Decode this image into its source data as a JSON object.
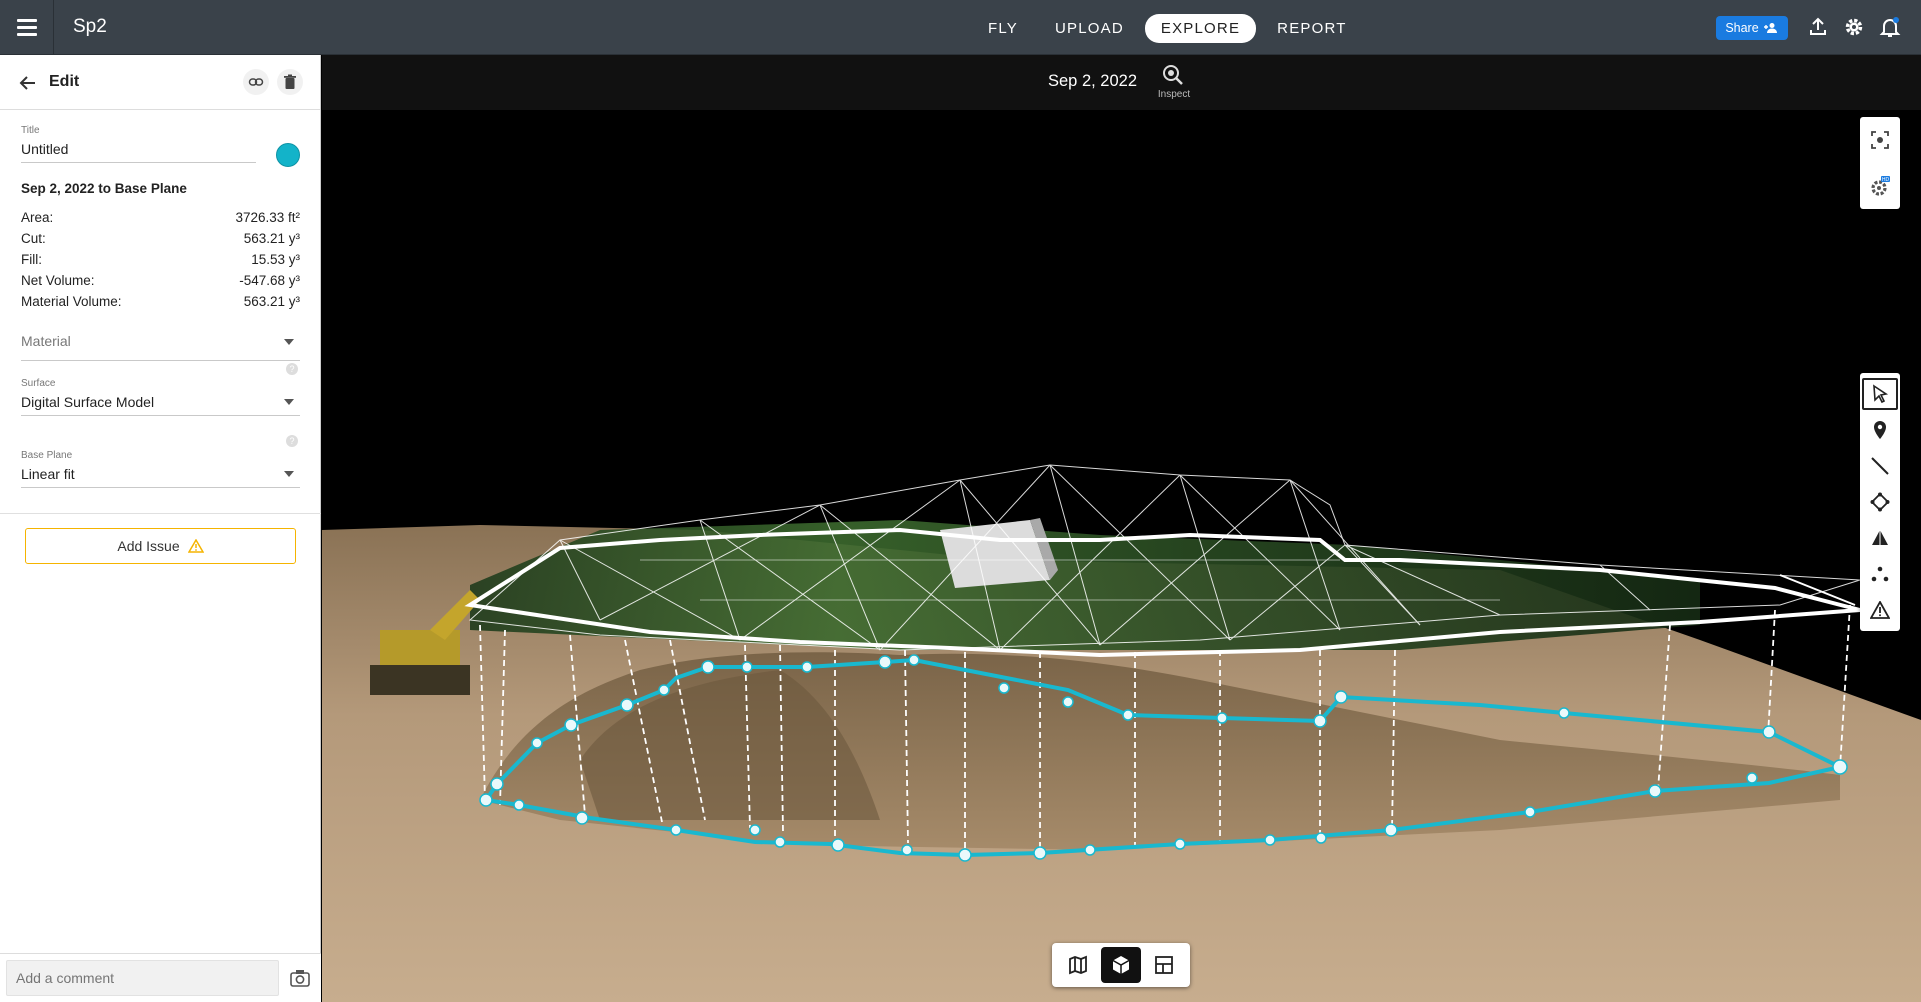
{
  "app": {
    "project_name": "Sp2"
  },
  "nav": {
    "tabs": [
      "FLY",
      "UPLOAD",
      "EXPLORE",
      "REPORT"
    ],
    "active_tab": "EXPLORE"
  },
  "header": {
    "share_label": "Share"
  },
  "panel": {
    "title": "Edit",
    "title_field": {
      "label": "Title",
      "value": "Untitled"
    },
    "comparison": "Sep 2, 2022 to Base Plane",
    "stats": [
      {
        "label": "Area:",
        "value": "3726.33 ft²"
      },
      {
        "label": "Cut:",
        "value": "563.21 y³"
      },
      {
        "label": "Fill:",
        "value": "15.53 y³"
      },
      {
        "label": "Net Volume:",
        "value": "-547.68 y³"
      },
      {
        "label": "Material Volume:",
        "value": "563.21 y³"
      }
    ],
    "material": {
      "placeholder": "Material"
    },
    "surface": {
      "label": "Surface",
      "value": "Digital Surface Model"
    },
    "base_plane": {
      "label": "Base Plane",
      "value": "Linear fit"
    },
    "add_issue_label": "Add Issue",
    "comment_placeholder": "Add a comment",
    "help_mark": "?"
  },
  "viewer": {
    "date": "Sep 2, 2022",
    "inspect_label": "Inspect",
    "hd_badge": "HD"
  },
  "colors": {
    "accent": "#1a7be0",
    "outline": "#13b3c9",
    "warning": "#f5b400",
    "topbar": "#3a424a"
  }
}
